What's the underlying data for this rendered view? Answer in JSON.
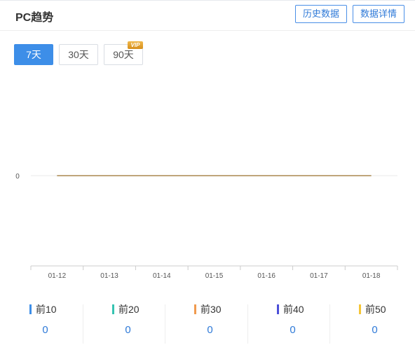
{
  "header": {
    "title": "PC趋势",
    "history_label": "历史数据",
    "detail_label": "数据详情"
  },
  "range_tabs": [
    {
      "label": "7天",
      "active": true
    },
    {
      "label": "30天",
      "active": false
    },
    {
      "label": "90天",
      "active": false,
      "badge": "VIP"
    }
  ],
  "chart_data": {
    "type": "line",
    "x": [
      "01-12",
      "01-13",
      "01-14",
      "01-15",
      "01-16",
      "01-17",
      "01-18"
    ],
    "y_ticks": [
      "0"
    ],
    "series": [
      {
        "values": [
          0,
          0,
          0,
          0,
          0,
          0,
          0
        ],
        "color": "#bfa57a"
      }
    ],
    "grid": true
  },
  "stats": [
    {
      "label": "前10",
      "value": "0",
      "color": "#3d8ee8"
    },
    {
      "label": "前20",
      "value": "0",
      "color": "#36c3b1"
    },
    {
      "label": "前30",
      "value": "0",
      "color": "#f09a4e"
    },
    {
      "label": "前40",
      "value": "0",
      "color": "#4b4fd8"
    },
    {
      "label": "前50",
      "value": "0",
      "color": "#f5c537"
    }
  ]
}
